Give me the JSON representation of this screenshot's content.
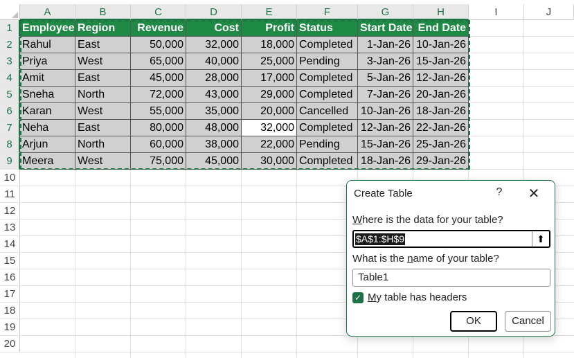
{
  "columns": [
    "A",
    "B",
    "C",
    "D",
    "E",
    "F",
    "G",
    "H",
    "I",
    "J"
  ],
  "rows": [
    "1",
    "2",
    "3",
    "4",
    "5",
    "6",
    "7",
    "8",
    "9",
    "10",
    "11",
    "12",
    "13",
    "14",
    "15",
    "16",
    "17",
    "18",
    "19",
    "20"
  ],
  "table": {
    "headers": [
      "Employee",
      "Region",
      "Revenue",
      "Cost",
      "Profit",
      "Status",
      "Start Date",
      "End Date"
    ],
    "data": [
      [
        "Rahul",
        "East",
        "50,000",
        "32,000",
        "18,000",
        "Completed",
        "1-Jan-26",
        "10-Jan-26"
      ],
      [
        "Priya",
        "West",
        "65,000",
        "40,000",
        "25,000",
        "Pending",
        "3-Jan-26",
        "15-Jan-26"
      ],
      [
        "Amit",
        "East",
        "45,000",
        "28,000",
        "17,000",
        "Completed",
        "5-Jan-26",
        "12-Jan-26"
      ],
      [
        "Sneha",
        "North",
        "72,000",
        "43,000",
        "29,000",
        "Completed",
        "7-Jan-26",
        "20-Jan-26"
      ],
      [
        "Karan",
        "West",
        "55,000",
        "35,000",
        "20,000",
        "Cancelled",
        "10-Jan-26",
        "18-Jan-26"
      ],
      [
        "Neha",
        "East",
        "80,000",
        "48,000",
        "32,000",
        "Completed",
        "12-Jan-26",
        "22-Jan-26"
      ],
      [
        "Arjun",
        "North",
        "60,000",
        "38,000",
        "22,000",
        "Pending",
        "15-Jan-26",
        "25-Jan-26"
      ],
      [
        "Meera",
        "West",
        "75,000",
        "45,000",
        "30,000",
        "Completed",
        "18-Jan-26",
        "29-Jan-26"
      ]
    ]
  },
  "dialog": {
    "title": "Create Table",
    "help": "?",
    "close": "✕",
    "range_label_pre": "",
    "range_label_u": "W",
    "range_label_post": "here is the data for your table?",
    "range_value": "$A$1:$H$9",
    "range_btn": "⬆",
    "name_label_pre": "What is the ",
    "name_label_u": "n",
    "name_label_post": "ame of your table?",
    "name_value": "Table1",
    "headers_label_u": "M",
    "headers_label_post": "y table has headers",
    "headers_checked": "✓",
    "ok_label": "OK",
    "cancel_label": "Cancel"
  },
  "colors": {
    "accent": "#1e7145",
    "header_fill": "#1e8a45",
    "selection_fill": "#d0d0d0"
  }
}
